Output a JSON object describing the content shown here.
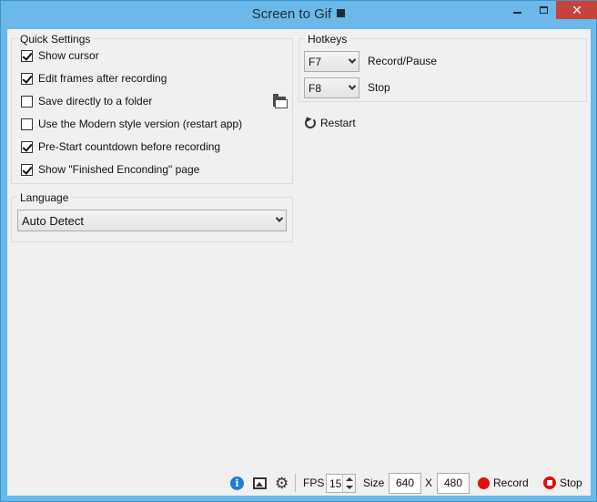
{
  "window": {
    "title": "Screen to Gif",
    "close_glyph": "✕"
  },
  "quick_settings": {
    "title": "Quick Settings",
    "items": [
      {
        "label": "Show cursor",
        "checked": true
      },
      {
        "label": "Edit frames after recording",
        "checked": true
      },
      {
        "label": "Save directly to a folder",
        "checked": false
      },
      {
        "label": "Use the Modern style version (restart app)",
        "checked": false
      },
      {
        "label": "Pre-Start countdown before recording",
        "checked": true
      },
      {
        "label": "Show \"Finished Enconding\" page",
        "checked": true
      }
    ]
  },
  "language": {
    "title": "Language",
    "selected": "Auto Detect"
  },
  "hotkeys": {
    "title": "Hotkeys",
    "record_key": "F7",
    "record_label": "Record/Pause",
    "stop_key": "F8",
    "stop_label": "Stop"
  },
  "restart": {
    "label": "Restart"
  },
  "bottombar": {
    "info_glyph": "i",
    "gear_glyph": "⚙",
    "fps_label": "FPS",
    "fps_value": "15",
    "size_label": "Size",
    "width": "640",
    "x_label": "X",
    "height": "480",
    "record_label": "Record",
    "stop_label": "Stop"
  },
  "colors": {
    "titlebar": "#6ab9ea",
    "close": "#c7433a",
    "record": "#e01010",
    "info": "#1d7ed6"
  }
}
